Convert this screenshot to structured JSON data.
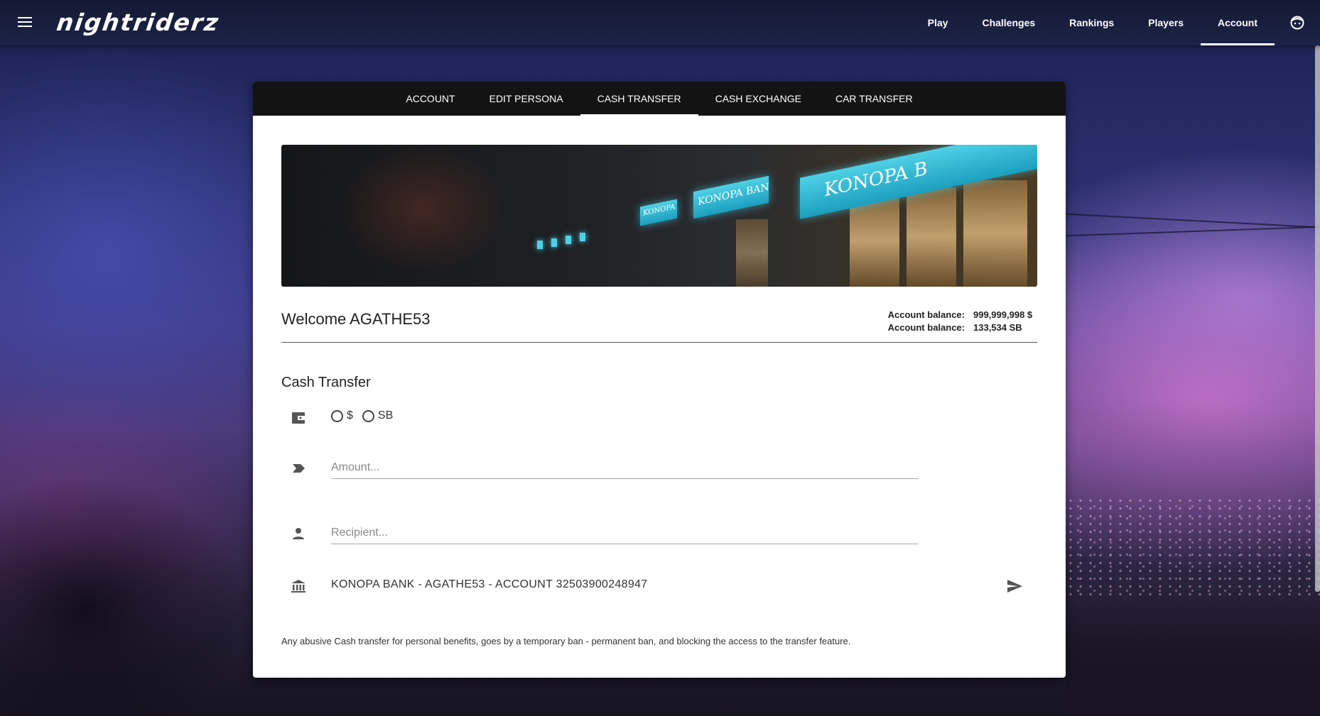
{
  "header": {
    "logo_text": "nightriderz",
    "nav": [
      {
        "label": "Play"
      },
      {
        "label": "Challenges"
      },
      {
        "label": "Rankings"
      },
      {
        "label": "Players"
      },
      {
        "label": "Account",
        "active": true
      }
    ]
  },
  "tabs": [
    {
      "label": "ACCOUNT"
    },
    {
      "label": "EDIT PERSONA"
    },
    {
      "label": "CASH TRANSFER",
      "active": true
    },
    {
      "label": "CASH EXCHANGE"
    },
    {
      "label": "CAR TRANSFER"
    }
  ],
  "banner": {
    "sign_large": "KONOPA B",
    "sign_medium": "KONOPA BANK",
    "sign_small": "KONOPA BAN"
  },
  "welcome": "Welcome AGATHE53",
  "balances": [
    {
      "label": "Account balance:",
      "value": "999,999,998 $"
    },
    {
      "label": "Account balance:",
      "value": "133,534 SB"
    }
  ],
  "cash_transfer": {
    "title": "Cash Transfer",
    "currency_options": [
      {
        "label": "$",
        "selected": false
      },
      {
        "label": "SB",
        "selected": false
      }
    ],
    "amount_placeholder": "Amount...",
    "recipient_placeholder": "Recipient...",
    "bank_account": "KONOPA BANK - AGATHE53 - ACCOUNT 32503900248947"
  },
  "notice": "Any abusive Cash transfer for personal benefits, goes by a temporary ban - permanent ban, and blocking the access to the transfer feature.",
  "colors": {
    "topbar": "#1c2347",
    "tab_bar": "#131313",
    "card": "#ffffff",
    "bank_sign": "#4fd0e6"
  },
  "icons": {
    "menu": "hamburger-icon",
    "user": "user-face-icon",
    "wallet": "wallet-icon",
    "label": "label-tag-icon",
    "person": "person-icon",
    "bank": "bank-icon",
    "send": "send-icon"
  }
}
